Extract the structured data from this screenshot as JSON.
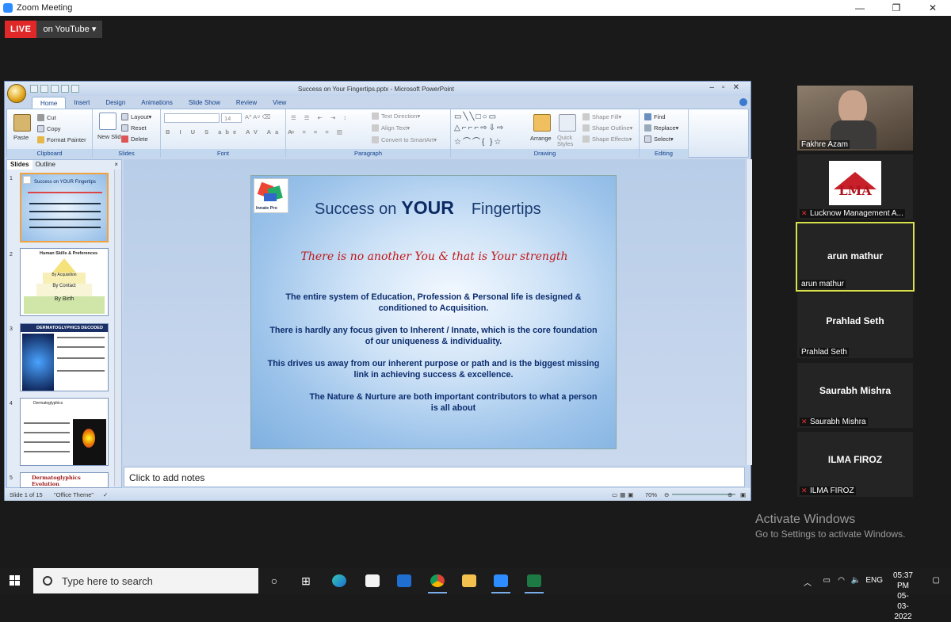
{
  "zoom": {
    "window_title": "Zoom Meeting",
    "live_label": "LIVE",
    "stream_label": "on YouTube",
    "window_controls": [
      "—",
      "❐",
      "✕"
    ]
  },
  "ppt": {
    "window_title": "Success on Your Fingertips.pptx - Microsoft PowerPoint",
    "tabs": [
      "Home",
      "Insert",
      "Design",
      "Animations",
      "Slide Show",
      "Review",
      "View"
    ],
    "ribbon": {
      "clipboard": {
        "label": "Clipboard",
        "paste": "Paste",
        "cut": "Cut",
        "copy": "Copy",
        "format_painter": "Format Painter"
      },
      "slides": {
        "label": "Slides",
        "new_slide": "New Slide",
        "layout": "Layout",
        "reset": "Reset",
        "delete": "Delete"
      },
      "font": {
        "label": "Font",
        "size": "14"
      },
      "paragraph": {
        "label": "Paragraph",
        "text_direction": "Text Direction",
        "align_text": "Align Text",
        "convert": "Convert to SmartArt"
      },
      "drawing": {
        "label": "Drawing",
        "arrange": "Arrange",
        "quick_styles": "Quick Styles",
        "shape_fill": "Shape Fill",
        "shape_outline": "Shape Outline",
        "shape_effects": "Shape Effects"
      },
      "editing": {
        "label": "Editing",
        "find": "Find",
        "replace": "Replace",
        "select": "Select"
      }
    },
    "pane_tabs": [
      "Slides",
      "Outline"
    ],
    "thumbnails": [
      {
        "num": "1",
        "title": "Success on YOUR Fingertips"
      },
      {
        "num": "2",
        "title": "Human Skills & Preferences",
        "tiers": [
          "By Acquisition",
          "By Contact",
          "By Birth"
        ]
      },
      {
        "num": "3",
        "title": "DERMATOGLYPHICS DECODED"
      },
      {
        "num": "4",
        "title": "Dermatoglyphics"
      },
      {
        "num": "5",
        "title": "Dermatoglyphics Evolution"
      }
    ],
    "slide": {
      "logo_text": "Innate Pro",
      "title_pre": "Success on",
      "title_bold": "YOUR",
      "title_post": "Fingertips",
      "subtitle": "There is no another You & that is Your strength",
      "paragraphs": [
        "The entire system of Education, Profession & Personal life is designed & conditioned to Acquisition.",
        "There is hardly any focus given to Inherent / Innate, which is the core foundation of our uniqueness & individuality.",
        "This drives us away from our inherent purpose or path and is the biggest missing link in achieving success & excellence.",
        "The Nature & Nurture are both important contributors to what a person is all about"
      ]
    },
    "notes_placeholder": "Click to add notes",
    "status": {
      "slide_info": "Slide 1 of 15",
      "theme": "\"Office Theme\"",
      "zoom": "70%"
    }
  },
  "participants": [
    {
      "name": "Fakhre Azam",
      "type": "video",
      "muted": false
    },
    {
      "name": "Lucknow Management A...",
      "type": "logo",
      "logo_text": "LMA",
      "muted": true
    },
    {
      "name": "arun mathur",
      "display": "arun mathur",
      "type": "name",
      "muted": false,
      "active": true
    },
    {
      "name": "Prahlad Seth",
      "display": "Prahlad Seth",
      "type": "name",
      "muted": false
    },
    {
      "name": "Saurabh Mishra",
      "display": "Saurabh Mishra",
      "type": "name",
      "muted": true
    },
    {
      "name": "ILMA FIROZ",
      "display": "ILMA FIROZ",
      "type": "name",
      "muted": true
    }
  ],
  "activate_windows": {
    "title": "Activate Windows",
    "subtitle": "Go to Settings to activate Windows."
  },
  "taskbar": {
    "search_placeholder": "Type here to search",
    "language": "ENG",
    "time": "05:37 PM",
    "date": "05-03-2022"
  },
  "colors": {
    "live_red": "#e02828",
    "zoom_blue": "#2d8cff",
    "active_speaker": "#d8e04a",
    "slide_title": "#0b2a63",
    "slide_subtitle": "#c01818"
  }
}
